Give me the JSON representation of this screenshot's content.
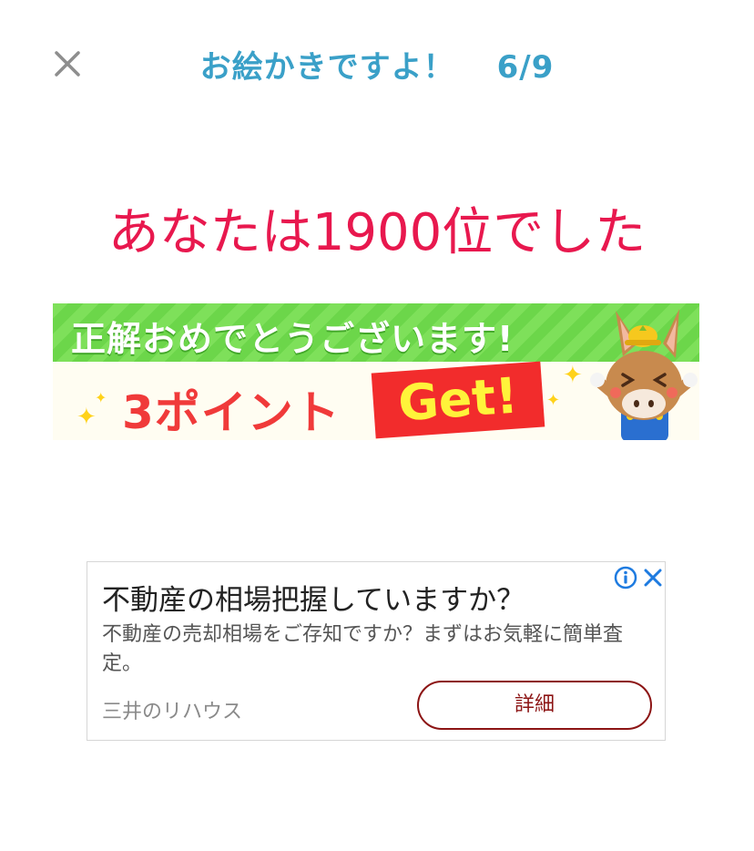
{
  "header": {
    "title": "お絵かきですよ！",
    "progress": "6/9"
  },
  "result": {
    "rank_text": "あなたは1900位でした"
  },
  "banner": {
    "congrats": "正解おめでとうございます!",
    "points": "3ポイント",
    "get": "Get!"
  },
  "ad": {
    "headline": "不動産の相場把握していますか？",
    "body": "不動産の売却相場をご存知ですか？まずはお気軽に簡単査定。",
    "advertiser": "三井のリハウス",
    "cta_label": "詳細"
  },
  "icons": {
    "close": "close-icon",
    "ad_info": "info-icon",
    "ad_close": "close-icon"
  },
  "colors": {
    "header": "#3aa0c8",
    "rank": "#e8184e",
    "banner_green": "#6cd64a",
    "points_red": "#f03a3a",
    "get_yellow": "#fff33a",
    "ad_cta": "#8c1414",
    "ad_icons": "#1e7be0"
  }
}
